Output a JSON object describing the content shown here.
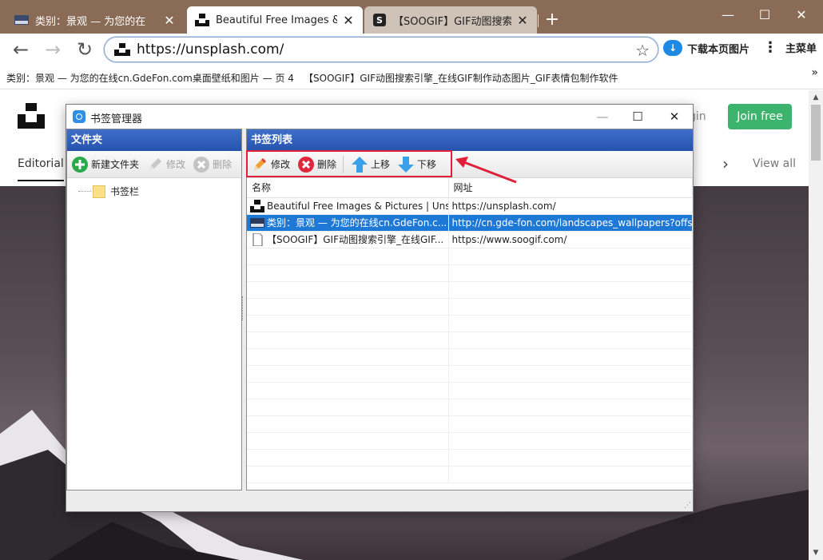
{
  "browser": {
    "tabs": [
      {
        "title": "类别：景观 — 为您的在",
        "active": false
      },
      {
        "title": "Beautiful Free Images & Pic",
        "active": true
      },
      {
        "title": "【SOOGIF】GIF动图搜索",
        "active": false
      }
    ],
    "url": "https://unsplash.com/",
    "download_label": "下载本页图片",
    "menu_label": "主菜单",
    "bookmarks_bar": [
      "类别：景观 — 为您的在线cn.GdeFon.com桌面壁纸和图片 — 页 4",
      "【SOOGIF】GIF动图搜索引擎_在线GIF制作动态图片_GIF表情包制作软件"
    ]
  },
  "page": {
    "join_label": "Join free",
    "login_label": "gin",
    "editorial_label": "Editorial",
    "view_all_label": "View all"
  },
  "dialog": {
    "title": "书签管理器",
    "folder_panel": {
      "header": "文件夹",
      "tools": {
        "new": "新建文件夹",
        "edit": "修改",
        "delete": "删除"
      },
      "tree": [
        "书签栏"
      ]
    },
    "list_panel": {
      "header": "书签列表",
      "tools": {
        "edit": "修改",
        "delete": "删除",
        "up": "上移",
        "down": "下移"
      },
      "columns": {
        "name": "名称",
        "url": "网址"
      },
      "rows": [
        {
          "name": "Beautiful Free Images & Pictures | Uns...",
          "url": "https://unsplash.com/",
          "icon": "unsplash-icon",
          "selected": false
        },
        {
          "name": "类别：景观 — 为您的在线cn.GdeFon.c...",
          "url": "http://cn.gde-fon.com/landscapes_wallpapers?offs...",
          "icon": "gdefon-icon",
          "selected": true
        },
        {
          "name": "【SOOGIF】GIF动图搜索引擎_在线GIF...",
          "url": "https://www.soogif.com/",
          "icon": "page-icon",
          "selected": false
        }
      ]
    }
  },
  "colors": {
    "titlebar": "#8a6b55",
    "panel_header": "#2552ad",
    "selection": "#1e78d6",
    "join_button": "#3cb46e",
    "highlight": "#e0203a"
  }
}
